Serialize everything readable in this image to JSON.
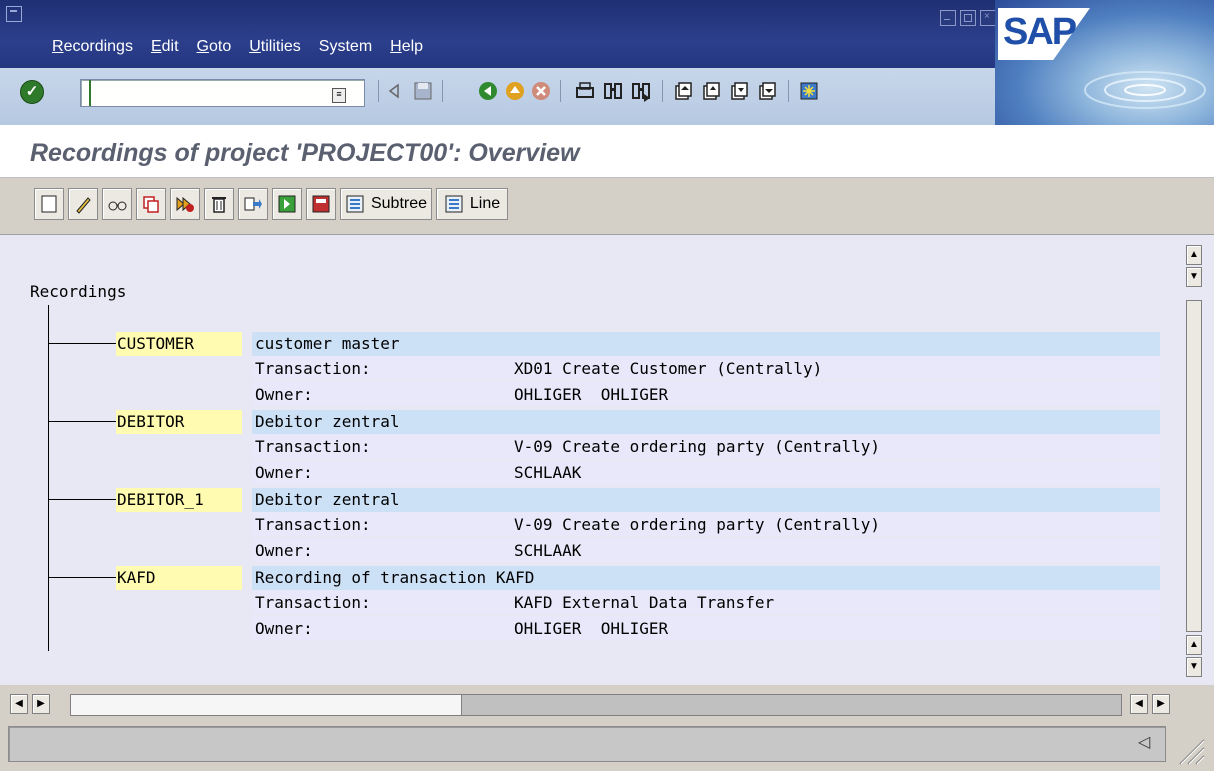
{
  "window": {
    "menu": [
      {
        "first": "R",
        "rest": "ecordings"
      },
      {
        "first": "E",
        "rest": "dit"
      },
      {
        "first": "G",
        "rest": "oto"
      },
      {
        "first": "U",
        "rest": "tilities"
      },
      {
        "first": "",
        "rest": "System"
      },
      {
        "first": "H",
        "rest": "elp"
      }
    ],
    "logo_text": "SAP"
  },
  "toolbar": {
    "command_value": "",
    "icons": [
      "enter-icon",
      "history-icon",
      "back-arrow-icon",
      "save-icon",
      "back-icon",
      "exit-icon",
      "cancel-icon",
      "print-icon",
      "find-icon",
      "find-next-icon",
      "first-page-icon",
      "previous-page-icon",
      "next-page-icon",
      "last-page-icon",
      "layout-icon"
    ]
  },
  "screen": {
    "title": "Recordings of project 'PROJECT00': Overview"
  },
  "app_toolbar": {
    "subtree_label": "Subtree",
    "line_label": "Line"
  },
  "tree": {
    "root_label": "Recordings",
    "recordings": [
      {
        "name": "CUSTOMER",
        "description": "customer master",
        "transaction_label": "Transaction:",
        "transaction": "XD01 Create Customer (Centrally)",
        "owner_label": "Owner:",
        "owner": "OHLIGER  OHLIGER"
      },
      {
        "name": "DEBITOR",
        "description": "Debitor zentral",
        "transaction_label": "Transaction:",
        "transaction": "V-09 Create ordering party (Centrally)",
        "owner_label": "Owner:",
        "owner": "SCHLAAK"
      },
      {
        "name": "DEBITOR_1",
        "description": "Debitor zentral",
        "transaction_label": "Transaction:",
        "transaction": "V-09 Create ordering party (Centrally)",
        "owner_label": "Owner:",
        "owner": "SCHLAAK"
      },
      {
        "name": "KAFD",
        "description": "Recording of transaction KAFD",
        "transaction_label": "Transaction:",
        "transaction": "KAFD External Data Transfer",
        "owner_label": "Owner:",
        "owner": "OHLIGER  OHLIGER"
      }
    ]
  },
  "colors": {
    "title_bar": "#243680",
    "name_highlight": "#fffbb0",
    "row_highlight": "#cce0f6"
  }
}
